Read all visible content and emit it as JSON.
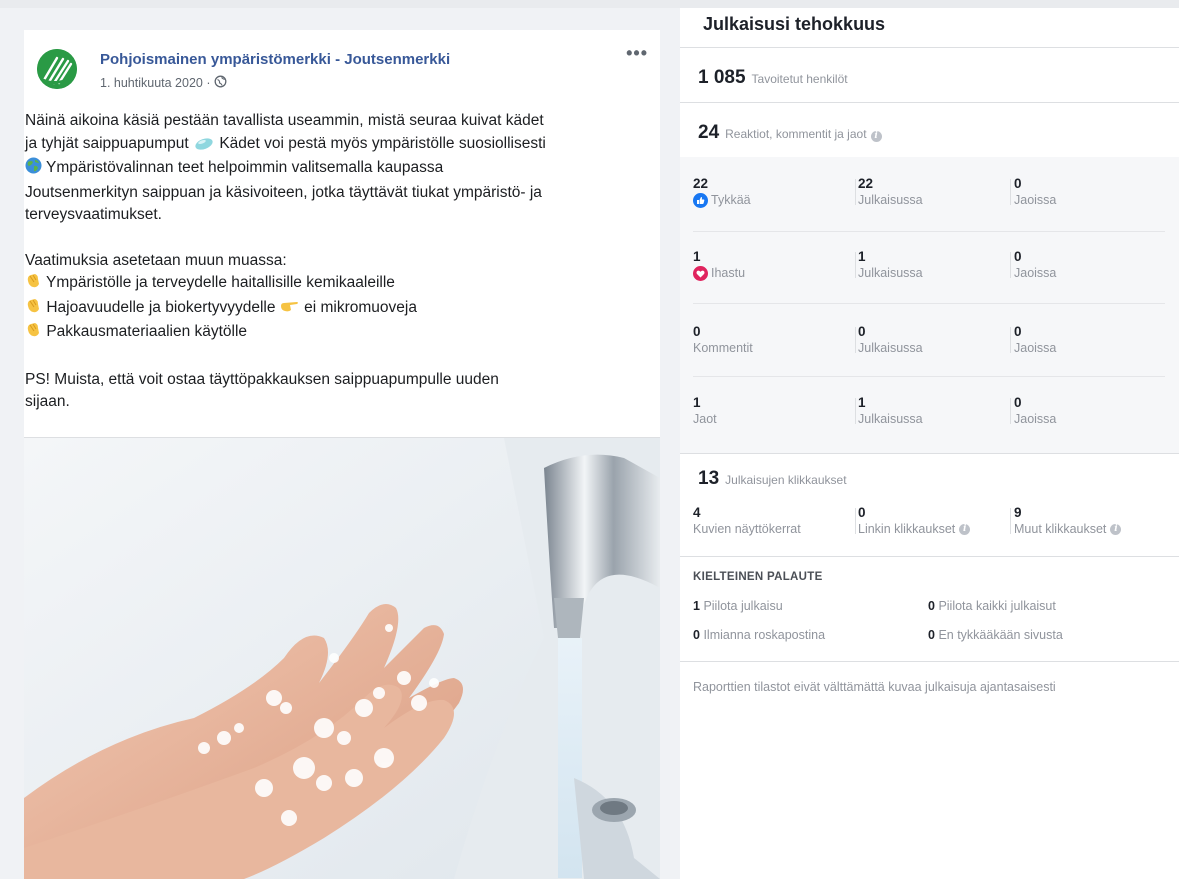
{
  "post": {
    "page_name": "Pohjoismainen ympäristömerkki - Joutsenmerkki",
    "date": "1. huhtikuuta 2020 ·",
    "lines": [
      "Näinä aikoina käsiä pestään tavallista useammin, mistä seuraa kuivat kädet",
      "ja tyhjät saippuapumput",
      "Kädet voi pestä myös ympäristölle suosiollisesti",
      "Ympäristövalinnan teet helpoimmin valitsemalla kaupassa",
      "Joutsenmerkityn saippuan ja käsivoiteen, jotka täyttävät tiukat ympäristö- ja",
      "terveysvaatimukset.",
      "Vaatimuksia asetetaan muun muassa:",
      "Ympäristölle ja terveydelle haitallisille kemikaaleille",
      "Hajoavuudelle ja biokertyvyydelle",
      "ei mikromuoveja",
      "Pakkausmateriaalien käytölle",
      "PS! Muista, että voit ostaa täyttöpakkauksen saippuapumpulle uuden",
      "sijaan."
    ],
    "icons": {
      "globe": "globe-icon",
      "more": "more-options-icon",
      "soap": "soap-emoji",
      "earth": "globe-earth-emoji",
      "clap": "clapping-hands-emoji",
      "point": "pointing-right-emoji"
    },
    "image_subject": "hands-washing-with-soap-under-faucet"
  },
  "stats": {
    "title": "Julkaisusi tehokkuus",
    "reach": {
      "num": "1 085",
      "label": "Tavoitetut henkilöt"
    },
    "engagement": {
      "num": "24",
      "label": "Reaktiot, kommentit ja jaot"
    },
    "rows": [
      {
        "num": "22",
        "label": "Tykkää",
        "icon": "like-icon",
        "post_num": "22",
        "post_label": "Julkaisussa",
        "share_num": "0",
        "share_label": "Jaoissa"
      },
      {
        "num": "1",
        "label": "Ihastu",
        "icon": "love-icon",
        "post_num": "1",
        "post_label": "Julkaisussa",
        "share_num": "0",
        "share_label": "Jaoissa"
      },
      {
        "num": "0",
        "label": "Kommentit",
        "icon": "",
        "post_num": "0",
        "post_label": "Julkaisussa",
        "share_num": "0",
        "share_label": "Jaoissa"
      },
      {
        "num": "1",
        "label": "Jaot",
        "icon": "",
        "post_num": "1",
        "post_label": "Julkaisussa",
        "share_num": "0",
        "share_label": "Jaoissa"
      }
    ],
    "clicks": {
      "num": "13",
      "label": "Julkaisujen klikkaukset",
      "items": [
        {
          "num": "4",
          "label": "Kuvien näyttökerrat"
        },
        {
          "num": "0",
          "label": "Linkin klikkaukset"
        },
        {
          "num": "9",
          "label": "Muut klikkaukset"
        }
      ]
    },
    "negative": {
      "title": "KIELTEINEN PALAUTE",
      "items": [
        {
          "num": "1",
          "label": "Piilota julkaisu"
        },
        {
          "num": "0",
          "label": "Piilota kaikki julkaisut"
        },
        {
          "num": "0",
          "label": "Ilmianna roskapostina"
        },
        {
          "num": "0",
          "label": "En tykkääkään sivusta"
        }
      ]
    },
    "footer": "Raporttien tilastot eivät välttämättä kuvaa julkaisuja ajantasaisesti",
    "colors": {
      "accent": "#385898",
      "like": "#1877f2",
      "love": "#e0245e",
      "muted": "#90949c"
    }
  }
}
